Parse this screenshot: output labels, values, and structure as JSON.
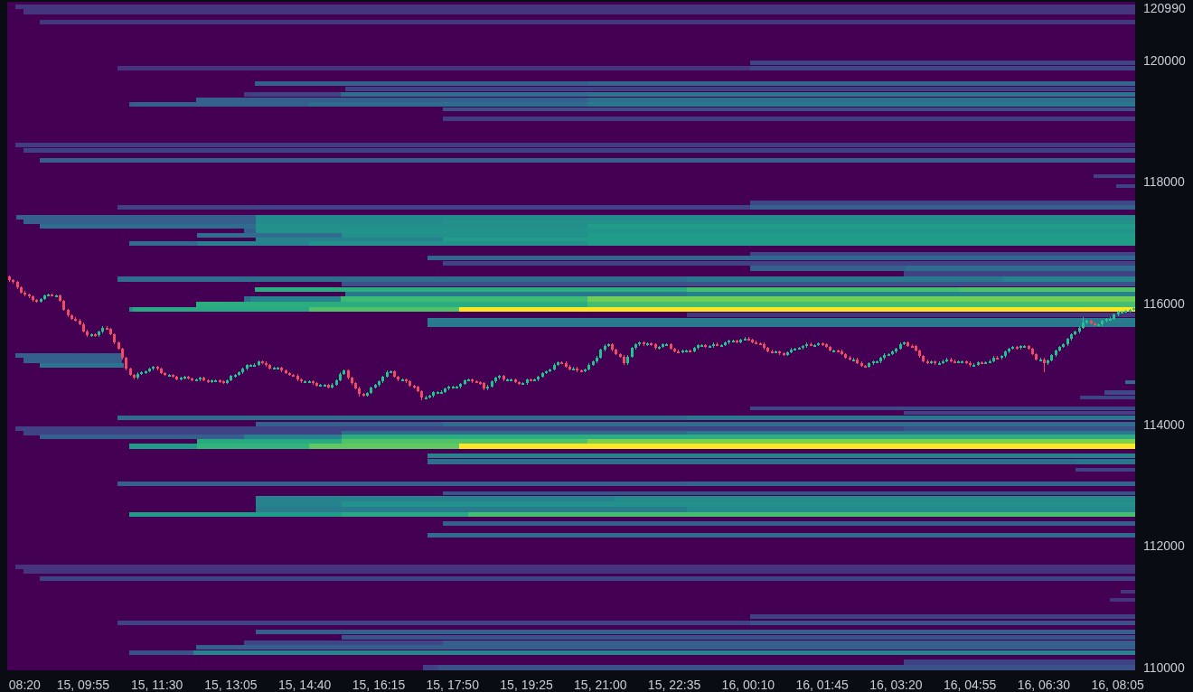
{
  "chart": {
    "chart_data": {
      "type": "candlestick",
      "ylim": [
        109970,
        120990
      ],
      "yticks": [
        {
          "value": 110000,
          "label": "110000"
        },
        {
          "value": 112000,
          "label": "112000"
        },
        {
          "value": 114000,
          "label": "114000"
        },
        {
          "value": 116000,
          "label": "116000"
        },
        {
          "value": 118000,
          "label": "118000"
        },
        {
          "value": 120000,
          "label": "120000"
        },
        {
          "value": 120990,
          "label": "120990"
        }
      ],
      "categories": [
        null,
        null,
        null,
        null,
        "08:20",
        null,
        null,
        null,
        null,
        null,
        null,
        null,
        null,
        null,
        null,
        null,
        null,
        null,
        null,
        "15, 09:55",
        null,
        null,
        null,
        null,
        null,
        null,
        null,
        null,
        null,
        null,
        null,
        null,
        null,
        null,
        null,
        null,
        null,
        null,
        "15, 11:30",
        null,
        null,
        null,
        null,
        null,
        null,
        null,
        null,
        null,
        null,
        null,
        null,
        null,
        null,
        null,
        null,
        null,
        null,
        "15, 13:05",
        null,
        null,
        null,
        null,
        null,
        null,
        null,
        null,
        null,
        null,
        null,
        null,
        null,
        null,
        null,
        null,
        null,
        null,
        "15, 14:40",
        null,
        null,
        null,
        null,
        null,
        null,
        null,
        null,
        null,
        null,
        null,
        null,
        null,
        null,
        null,
        null,
        null,
        null,
        "15, 16:15",
        null,
        null,
        null,
        null,
        null,
        null,
        null,
        null,
        null,
        null,
        null,
        null,
        null,
        null,
        null,
        null,
        null,
        null,
        "15, 17:50",
        null,
        null,
        null,
        null,
        null,
        null,
        null,
        null,
        null,
        null,
        null,
        null,
        null,
        null,
        null,
        null,
        null,
        null,
        "15, 19:25",
        null,
        null,
        null,
        null,
        null,
        null,
        null,
        null,
        null,
        null,
        null,
        null,
        null,
        null,
        null,
        null,
        null,
        null,
        "15, 21:00",
        null,
        null,
        null,
        null,
        null,
        null,
        null,
        null,
        null,
        null,
        null,
        null,
        null,
        null,
        null,
        null,
        null,
        null,
        "15, 22:35",
        null,
        null,
        null,
        null,
        null,
        null,
        null,
        null,
        null,
        null,
        null,
        null,
        null,
        null,
        null,
        null,
        null,
        null,
        "16, 00:10",
        null,
        null,
        null,
        null,
        null,
        null,
        null,
        null,
        null,
        null,
        null,
        null,
        null,
        null,
        null,
        null,
        null,
        null,
        "16, 01:45",
        null,
        null,
        null,
        null,
        null,
        null,
        null,
        null,
        null,
        null,
        null,
        null,
        null,
        null,
        null,
        null,
        null,
        null,
        "16, 03:20",
        null,
        null,
        null,
        null,
        null,
        null,
        null,
        null,
        null,
        null,
        null,
        null,
        null,
        null,
        null,
        null,
        null,
        null,
        "16, 04:55",
        null,
        null,
        null,
        null,
        null,
        null,
        null,
        null,
        null,
        null,
        null,
        null,
        null,
        null,
        null,
        null,
        null,
        null,
        "16, 06:30",
        null,
        null,
        null,
        null,
        null,
        null,
        null,
        null,
        null,
        null,
        null,
        null,
        null,
        null,
        null,
        null,
        null,
        null,
        "16, 08:05",
        null,
        null,
        null,
        null
      ],
      "ohlc": [
        [
          116460,
          116480,
          116380,
          116400
        ],
        [
          116400,
          116420,
          116350,
          116370
        ],
        [
          116370,
          116390,
          116260,
          116280
        ],
        [
          116280,
          116300,
          116180,
          116200
        ],
        [
          116200,
          116220,
          116140,
          116160
        ],
        [
          116160,
          116180,
          116110,
          116130
        ],
        [
          116130,
          116150,
          116050,
          116070
        ],
        [
          116070,
          116090,
          116030,
          116050
        ],
        [
          116050,
          116110,
          116030,
          116090
        ],
        [
          116090,
          116170,
          116070,
          116150
        ],
        [
          116150,
          116180,
          116130,
          116160
        ],
        [
          116160,
          116180,
          116130,
          116150
        ],
        [
          116150,
          116170,
          116130,
          116150
        ],
        [
          116150,
          116170,
          116040,
          116060
        ],
        [
          116060,
          116080,
          115890,
          115910
        ],
        [
          115910,
          115930,
          115800,
          115820
        ],
        [
          115820,
          115840,
          115750,
          115770
        ],
        [
          115770,
          115790,
          115720,
          115740
        ],
        [
          115740,
          115760,
          115660,
          115680
        ],
        [
          115680,
          115700,
          115540,
          115560
        ],
        [
          115560,
          115580,
          115470,
          115490
        ],
        [
          115490,
          115530,
          115470,
          115510
        ],
        [
          115510,
          115530,
          115470,
          115490
        ],
        [
          115490,
          115570,
          115470,
          115550
        ],
        [
          115550,
          115640,
          115530,
          115620
        ],
        [
          115620,
          115640,
          115580,
          115600
        ],
        [
          115600,
          115620,
          115490,
          115510
        ],
        [
          115510,
          115530,
          115350,
          115370
        ],
        [
          115370,
          115390,
          115250,
          115270
        ],
        [
          115270,
          115290,
          115100,
          115120
        ],
        [
          115120,
          115140,
          114920,
          114940
        ],
        [
          114940,
          114960,
          114820,
          114840
        ],
        [
          114840,
          114860,
          114770,
          114790
        ],
        [
          114790,
          114880,
          114770,
          114860
        ],
        [
          114860,
          114900,
          114840,
          114880
        ],
        [
          114880,
          114920,
          114860,
          114900
        ],
        [
          114900,
          114960,
          114880,
          114940
        ],
        [
          114940,
          114990,
          114920,
          114970
        ],
        [
          114970,
          114990,
          114920,
          114940
        ],
        [
          114940,
          114960,
          114850,
          114870
        ],
        [
          114870,
          114890,
          114820,
          114840
        ],
        [
          114840,
          114860,
          114820,
          114840
        ],
        [
          114840,
          114860,
          114790,
          114810
        ],
        [
          114810,
          114830,
          114750,
          114770
        ],
        [
          114770,
          114810,
          114750,
          114790
        ],
        [
          114790,
          114830,
          114770,
          114810
        ],
        [
          114810,
          114830,
          114760,
          114780
        ],
        [
          114780,
          114800,
          114740,
          114760
        ],
        [
          114760,
          114780,
          114740,
          114760
        ],
        [
          114760,
          114810,
          114740,
          114790
        ],
        [
          114790,
          114810,
          114730,
          114750
        ],
        [
          114750,
          114770,
          114710,
          114730
        ],
        [
          114730,
          114770,
          114710,
          114750
        ],
        [
          114750,
          114770,
          114730,
          114750
        ],
        [
          114750,
          114770,
          114710,
          114730
        ],
        [
          114730,
          114750,
          114690,
          114710
        ],
        [
          114710,
          114770,
          114690,
          114750
        ],
        [
          114750,
          114840,
          114730,
          114820
        ],
        [
          114820,
          114860,
          114800,
          114840
        ],
        [
          114840,
          114900,
          114820,
          114880
        ],
        [
          114880,
          114960,
          114860,
          114940
        ],
        [
          114940,
          115020,
          114920,
          115000
        ],
        [
          115000,
          115020,
          114980,
          115000
        ],
        [
          115000,
          115030,
          114980,
          115010
        ],
        [
          115010,
          115080,
          114990,
          115060
        ],
        [
          115060,
          115080,
          115020,
          115040
        ],
        [
          115040,
          115060,
          114980,
          115000
        ],
        [
          115000,
          115020,
          114930,
          114950
        ],
        [
          114950,
          114980,
          114930,
          114960
        ],
        [
          114960,
          114980,
          114940,
          114960
        ],
        [
          114960,
          114980,
          114890,
          114910
        ],
        [
          114910,
          114930,
          114850,
          114870
        ],
        [
          114870,
          114890,
          114820,
          114840
        ],
        [
          114840,
          114860,
          114810,
          114830
        ],
        [
          114830,
          114850,
          114740,
          114760
        ],
        [
          114760,
          114780,
          114710,
          114730
        ],
        [
          114730,
          114750,
          114710,
          114730
        ],
        [
          114730,
          114750,
          114710,
          114730
        ],
        [
          114730,
          114750,
          114680,
          114700
        ],
        [
          114700,
          114720,
          114640,
          114660
        ],
        [
          114660,
          114690,
          114640,
          114670
        ],
        [
          114670,
          114690,
          114650,
          114670
        ],
        [
          114670,
          114690,
          114610,
          114630
        ],
        [
          114630,
          114700,
          114610,
          114680
        ],
        [
          114680,
          114770,
          114660,
          114750
        ],
        [
          114750,
          114880,
          114730,
          114860
        ],
        [
          114860,
          114930,
          114840,
          114910
        ],
        [
          114910,
          114930,
          114770,
          114790
        ],
        [
          114790,
          114810,
          114680,
          114700
        ],
        [
          114700,
          114720,
          114600,
          114620
        ],
        [
          114620,
          114640,
          114480,
          114520
        ],
        [
          114520,
          114540,
          114480,
          114500
        ],
        [
          114500,
          114560,
          114480,
          114540
        ],
        [
          114540,
          114650,
          114520,
          114630
        ],
        [
          114630,
          114690,
          114610,
          114670
        ],
        [
          114670,
          114750,
          114650,
          114730
        ],
        [
          114730,
          114830,
          114710,
          114810
        ],
        [
          114810,
          114910,
          114790,
          114890
        ],
        [
          114890,
          114920,
          114870,
          114900
        ],
        [
          114900,
          114920,
          114790,
          114810
        ],
        [
          114810,
          114830,
          114740,
          114760
        ],
        [
          114760,
          114780,
          114740,
          114760
        ],
        [
          114760,
          114780,
          114710,
          114730
        ],
        [
          114730,
          114750,
          114640,
          114660
        ],
        [
          114660,
          114680,
          114620,
          114640
        ],
        [
          114640,
          114660,
          114550,
          114570
        ],
        [
          114570,
          114590,
          114420,
          114460
        ],
        [
          114460,
          114490,
          114440,
          114470
        ],
        [
          114470,
          114510,
          114450,
          114490
        ],
        [
          114490,
          114570,
          114470,
          114550
        ],
        [
          114550,
          114570,
          114530,
          114550
        ],
        [
          114550,
          114580,
          114530,
          114560
        ],
        [
          114560,
          114630,
          114540,
          114610
        ],
        [
          114610,
          114660,
          114590,
          114640
        ],
        [
          114640,
          114660,
          114620,
          114640
        ],
        [
          114640,
          114660,
          114620,
          114640
        ],
        [
          114640,
          114710,
          114620,
          114690
        ],
        [
          114690,
          114770,
          114670,
          114750
        ],
        [
          114750,
          114780,
          114730,
          114760
        ],
        [
          114760,
          114780,
          114710,
          114730
        ],
        [
          114730,
          114750,
          114700,
          114720
        ],
        [
          114720,
          114740,
          114680,
          114700
        ],
        [
          114700,
          114720,
          114590,
          114610
        ],
        [
          114610,
          114670,
          114590,
          114650
        ],
        [
          114650,
          114750,
          114630,
          114730
        ],
        [
          114730,
          114810,
          114710,
          114790
        ],
        [
          114790,
          114840,
          114770,
          114820
        ],
        [
          114820,
          114840,
          114740,
          114760
        ],
        [
          114760,
          114780,
          114740,
          114760
        ],
        [
          114760,
          114780,
          114740,
          114760
        ],
        [
          114760,
          114780,
          114700,
          114720
        ],
        [
          114720,
          114740,
          114680,
          114700
        ],
        [
          114700,
          114720,
          114680,
          114700
        ],
        [
          114700,
          114780,
          114680,
          114760
        ],
        [
          114760,
          114780,
          114730,
          114750
        ],
        [
          114750,
          114780,
          114730,
          114760
        ],
        [
          114760,
          114830,
          114740,
          114810
        ],
        [
          114810,
          114890,
          114790,
          114870
        ],
        [
          114870,
          114920,
          114850,
          114900
        ],
        [
          114900,
          114950,
          114880,
          114930
        ],
        [
          114930,
          115030,
          114910,
          115010
        ],
        [
          115010,
          115070,
          114990,
          115050
        ],
        [
          115050,
          115070,
          115020,
          115040
        ],
        [
          115040,
          115060,
          114960,
          114980
        ],
        [
          114980,
          115000,
          114910,
          114930
        ],
        [
          114930,
          114970,
          114910,
          114950
        ],
        [
          114950,
          114970,
          114890,
          114910
        ],
        [
          114910,
          114930,
          114880,
          114900
        ],
        [
          114900,
          114950,
          114880,
          114930
        ],
        [
          114930,
          115030,
          114910,
          115010
        ],
        [
          115010,
          115080,
          114990,
          115060
        ],
        [
          115060,
          115150,
          115040,
          115130
        ],
        [
          115130,
          115270,
          115110,
          115250
        ],
        [
          115250,
          115340,
          115230,
          115320
        ],
        [
          115320,
          115360,
          115300,
          115340
        ],
        [
          115340,
          115360,
          115230,
          115250
        ],
        [
          115250,
          115270,
          115160,
          115180
        ],
        [
          115180,
          115200,
          115120,
          115140
        ],
        [
          115140,
          115160,
          115010,
          115030
        ],
        [
          115030,
          115160,
          115010,
          115140
        ],
        [
          115140,
          115300,
          115120,
          115280
        ],
        [
          115280,
          115360,
          115260,
          115340
        ],
        [
          115340,
          115390,
          115320,
          115370
        ],
        [
          115370,
          115390,
          115320,
          115340
        ],
        [
          115340,
          115380,
          115320,
          115360
        ],
        [
          115360,
          115380,
          115320,
          115340
        ],
        [
          115340,
          115360,
          115260,
          115280
        ],
        [
          115280,
          115320,
          115260,
          115300
        ],
        [
          115300,
          115360,
          115280,
          115340
        ],
        [
          115340,
          115360,
          115320,
          115340
        ],
        [
          115340,
          115360,
          115250,
          115270
        ],
        [
          115270,
          115290,
          115210,
          115230
        ],
        [
          115230,
          115250,
          115200,
          115220
        ],
        [
          115220,
          115260,
          115200,
          115240
        ],
        [
          115240,
          115260,
          115220,
          115240
        ],
        [
          115240,
          115260,
          115210,
          115230
        ],
        [
          115230,
          115300,
          115210,
          115280
        ],
        [
          115280,
          115350,
          115260,
          115330
        ],
        [
          115330,
          115350,
          115310,
          115330
        ],
        [
          115330,
          115350,
          115290,
          115310
        ],
        [
          115310,
          115330,
          115290,
          115310
        ],
        [
          115310,
          115370,
          115290,
          115350
        ],
        [
          115350,
          115370,
          115310,
          115330
        ],
        [
          115330,
          115350,
          115310,
          115330
        ],
        [
          115330,
          115390,
          115310,
          115370
        ],
        [
          115370,
          115420,
          115350,
          115400
        ],
        [
          115400,
          115420,
          115380,
          115400
        ],
        [
          115400,
          115420,
          115360,
          115380
        ],
        [
          115380,
          115440,
          115360,
          115420
        ],
        [
          115420,
          115460,
          115400,
          115440
        ],
        [
          115440,
          115460,
          115400,
          115420
        ],
        [
          115420,
          115440,
          115360,
          115380
        ],
        [
          115380,
          115400,
          115340,
          115360
        ],
        [
          115360,
          115380,
          115330,
          115350
        ],
        [
          115350,
          115370,
          115260,
          115280
        ],
        [
          115280,
          115300,
          115210,
          115230
        ],
        [
          115230,
          115250,
          115200,
          115220
        ],
        [
          115220,
          115240,
          115200,
          115220
        ],
        [
          115220,
          115240,
          115170,
          115190
        ],
        [
          115190,
          115210,
          115150,
          115170
        ],
        [
          115170,
          115230,
          115150,
          115210
        ],
        [
          115210,
          115280,
          115190,
          115260
        ],
        [
          115260,
          115290,
          115240,
          115270
        ],
        [
          115270,
          115300,
          115250,
          115280
        ],
        [
          115280,
          115330,
          115260,
          115310
        ],
        [
          115310,
          115370,
          115290,
          115350
        ],
        [
          115350,
          115370,
          115310,
          115330
        ],
        [
          115330,
          115350,
          115310,
          115330
        ],
        [
          115330,
          115380,
          115310,
          115360
        ],
        [
          115360,
          115380,
          115320,
          115340
        ],
        [
          115340,
          115360,
          115280,
          115300
        ],
        [
          115300,
          115320,
          115220,
          115240
        ],
        [
          115240,
          115260,
          115220,
          115240
        ],
        [
          115240,
          115260,
          115210,
          115230
        ],
        [
          115230,
          115250,
          115160,
          115180
        ],
        [
          115180,
          115200,
          115110,
          115130
        ],
        [
          115130,
          115150,
          115080,
          115100
        ],
        [
          115100,
          115120,
          115080,
          115100
        ],
        [
          115100,
          115120,
          115020,
          115040
        ],
        [
          115040,
          115060,
          114970,
          114990
        ],
        [
          114990,
          115010,
          114960,
          114980
        ],
        [
          114980,
          115050,
          114960,
          115030
        ],
        [
          115030,
          115080,
          115010,
          115060
        ],
        [
          115060,
          115080,
          115040,
          115060
        ],
        [
          115060,
          115140,
          115040,
          115120
        ],
        [
          115120,
          115190,
          115100,
          115170
        ],
        [
          115170,
          115200,
          115150,
          115180
        ],
        [
          115180,
          115240,
          115160,
          115220
        ],
        [
          115220,
          115290,
          115200,
          115270
        ],
        [
          115270,
          115370,
          115250,
          115350
        ],
        [
          115350,
          115390,
          115330,
          115370
        ],
        [
          115370,
          115390,
          115300,
          115320
        ],
        [
          115320,
          115340,
          115290,
          115310
        ],
        [
          115310,
          115330,
          115220,
          115240
        ],
        [
          115240,
          115260,
          115130,
          115150
        ],
        [
          115150,
          115170,
          115050,
          115070
        ],
        [
          115070,
          115090,
          115020,
          115040
        ],
        [
          115040,
          115080,
          115020,
          115060
        ],
        [
          115060,
          115080,
          115010,
          115030
        ],
        [
          115030,
          115060,
          115010,
          115040
        ],
        [
          115040,
          115090,
          115020,
          115070
        ],
        [
          115070,
          115120,
          115050,
          115100
        ],
        [
          115100,
          115120,
          115050,
          115070
        ],
        [
          115070,
          115090,
          115030,
          115050
        ],
        [
          115050,
          115080,
          115030,
          115060
        ],
        [
          115060,
          115080,
          115040,
          115060
        ],
        [
          115060,
          115080,
          115020,
          115040
        ],
        [
          115040,
          115060,
          114980,
          115000
        ],
        [
          115000,
          115030,
          114980,
          115010
        ],
        [
          115010,
          115070,
          114990,
          115050
        ],
        [
          115050,
          115070,
          115020,
          115040
        ],
        [
          115040,
          115070,
          115020,
          115050
        ],
        [
          115050,
          115090,
          115030,
          115070
        ],
        [
          115070,
          115150,
          115050,
          115130
        ],
        [
          115130,
          115150,
          115100,
          115120
        ],
        [
          115120,
          115170,
          115100,
          115150
        ],
        [
          115150,
          115240,
          115130,
          115220
        ],
        [
          115220,
          115290,
          115200,
          115270
        ],
        [
          115270,
          115320,
          115250,
          115300
        ],
        [
          115300,
          115320,
          115260,
          115280
        ],
        [
          115280,
          115330,
          115260,
          115310
        ],
        [
          115310,
          115330,
          115290,
          115310
        ],
        [
          115310,
          115330,
          115250,
          115270
        ],
        [
          115270,
          115290,
          115160,
          115180
        ],
        [
          115180,
          115200,
          115080,
          115100
        ],
        [
          115100,
          115120,
          115080,
          115100
        ],
        [
          115100,
          115120,
          114880,
          115030
        ],
        [
          115030,
          115100,
          115010,
          115080
        ],
        [
          115080,
          115180,
          115060,
          115160
        ],
        [
          115160,
          115260,
          115140,
          115240
        ],
        [
          115240,
          115320,
          115220,
          115300
        ],
        [
          115300,
          115360,
          115280,
          115340
        ],
        [
          115340,
          115450,
          115320,
          115430
        ],
        [
          115430,
          115530,
          115410,
          115510
        ],
        [
          115510,
          115570,
          115490,
          115550
        ],
        [
          115550,
          115640,
          115530,
          115620
        ],
        [
          115620,
          115800,
          115600,
          115700
        ],
        [
          115700,
          115750,
          115680,
          115730
        ],
        [
          115730,
          115750,
          115670,
          115690
        ],
        [
          115690,
          115710,
          115640,
          115660
        ],
        [
          115660,
          115690,
          115640,
          115670
        ],
        [
          115670,
          115750,
          115650,
          115730
        ],
        [
          115730,
          115780,
          115710,
          115760
        ],
        [
          115760,
          115790,
          115740,
          115770
        ],
        [
          115770,
          115850,
          115750,
          115830
        ],
        [
          115830,
          115900,
          115810,
          115880
        ],
        [
          115880,
          115900,
          115860,
          115880
        ],
        [
          115880,
          115910,
          115860,
          115890
        ],
        [
          115890,
          115930,
          115870,
          115910
        ],
        [
          115910,
          115960,
          115890,
          115940
        ]
      ]
    }
  }
}
